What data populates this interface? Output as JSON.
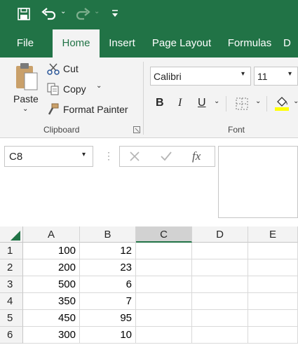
{
  "quick_access": {
    "save_icon": "save-icon",
    "undo_icon": "undo-icon",
    "redo_icon": "redo-icon",
    "customize_icon": "customize-icon"
  },
  "tabs": [
    {
      "label": "File"
    },
    {
      "label": "Home",
      "active": true
    },
    {
      "label": "Insert"
    },
    {
      "label": "Page Layout"
    },
    {
      "label": "Formulas"
    },
    {
      "label": "D"
    }
  ],
  "clipboard": {
    "paste_label": "Paste",
    "cut_label": "Cut",
    "copy_label": "Copy",
    "format_painter_label": "Format Painter",
    "group_label": "Clipboard"
  },
  "font": {
    "family": "Calibri",
    "size": "11",
    "bold": "B",
    "italic": "I",
    "underline": "U",
    "group_label": "Font"
  },
  "formula_bar": {
    "name_box": "C8",
    "fx": "fx",
    "content": ""
  },
  "grid": {
    "columns": [
      "A",
      "B",
      "C",
      "D",
      "E"
    ],
    "selected_column": "C",
    "rows": [
      {
        "n": "1",
        "a": "100",
        "b": "12"
      },
      {
        "n": "2",
        "a": "200",
        "b": "23"
      },
      {
        "n": "3",
        "a": "500",
        "b": "6"
      },
      {
        "n": "4",
        "a": "350",
        "b": "7"
      },
      {
        "n": "5",
        "a": "450",
        "b": "95"
      },
      {
        "n": "6",
        "a": "300",
        "b": "10"
      }
    ]
  },
  "colors": {
    "brand": "#217346",
    "ribbon": "#f3f3f3",
    "highlight": "#ffff00"
  }
}
